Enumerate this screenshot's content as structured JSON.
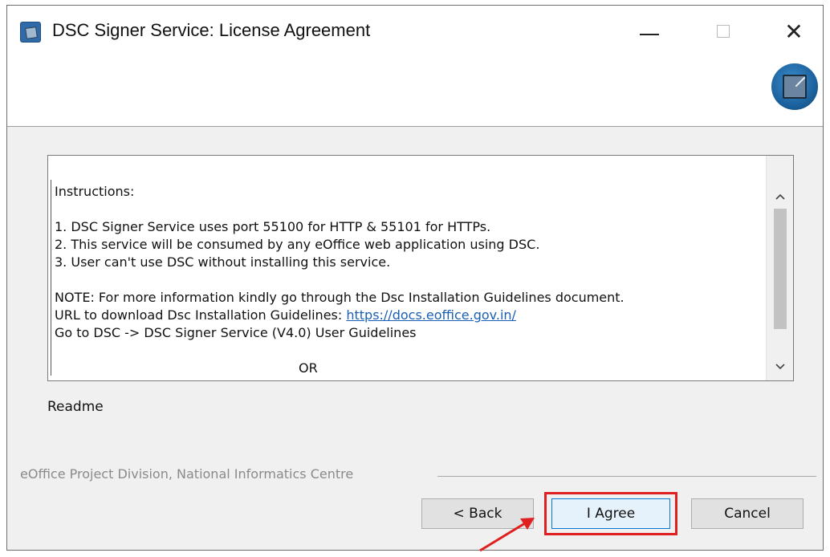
{
  "window": {
    "title": "DSC Signer Service: License Agreement"
  },
  "icons": {
    "app": "pen-signature-icon",
    "header_logo": "signature-logo-icon",
    "minimize": "minimize-icon",
    "maximize": "maximize-icon",
    "close": "close-icon"
  },
  "controls": {
    "close_glyph": "✕"
  },
  "license": {
    "heading": "Instructions:",
    "items": [
      "1. DSC Signer Service uses port 55100 for HTTP & 55101 for HTTPs.",
      "2. This service will be consumed by any eOffice web application using DSC.",
      "3. User can't use DSC without installing this service."
    ],
    "note": "NOTE: For more information kindly go through the Dsc Installation Guidelines document.",
    "url_prefix": "URL to download Dsc Installation Guidelines: ",
    "url_link": "https://docs.eoffice.gov.in/",
    "path": "Go to DSC -> DSC Signer Service (V4.0) User Guidelines",
    "or": "OR"
  },
  "readme_label": "Readme",
  "footer": {
    "branding": "eOffice Project Division, National Informatics Centre"
  },
  "buttons": {
    "back": "< Back",
    "agree": "I Agree",
    "cancel": "Cancel"
  },
  "colors": {
    "highlight": "#e02020",
    "link": "#1a5fb4",
    "focus_border": "#0078d7"
  }
}
